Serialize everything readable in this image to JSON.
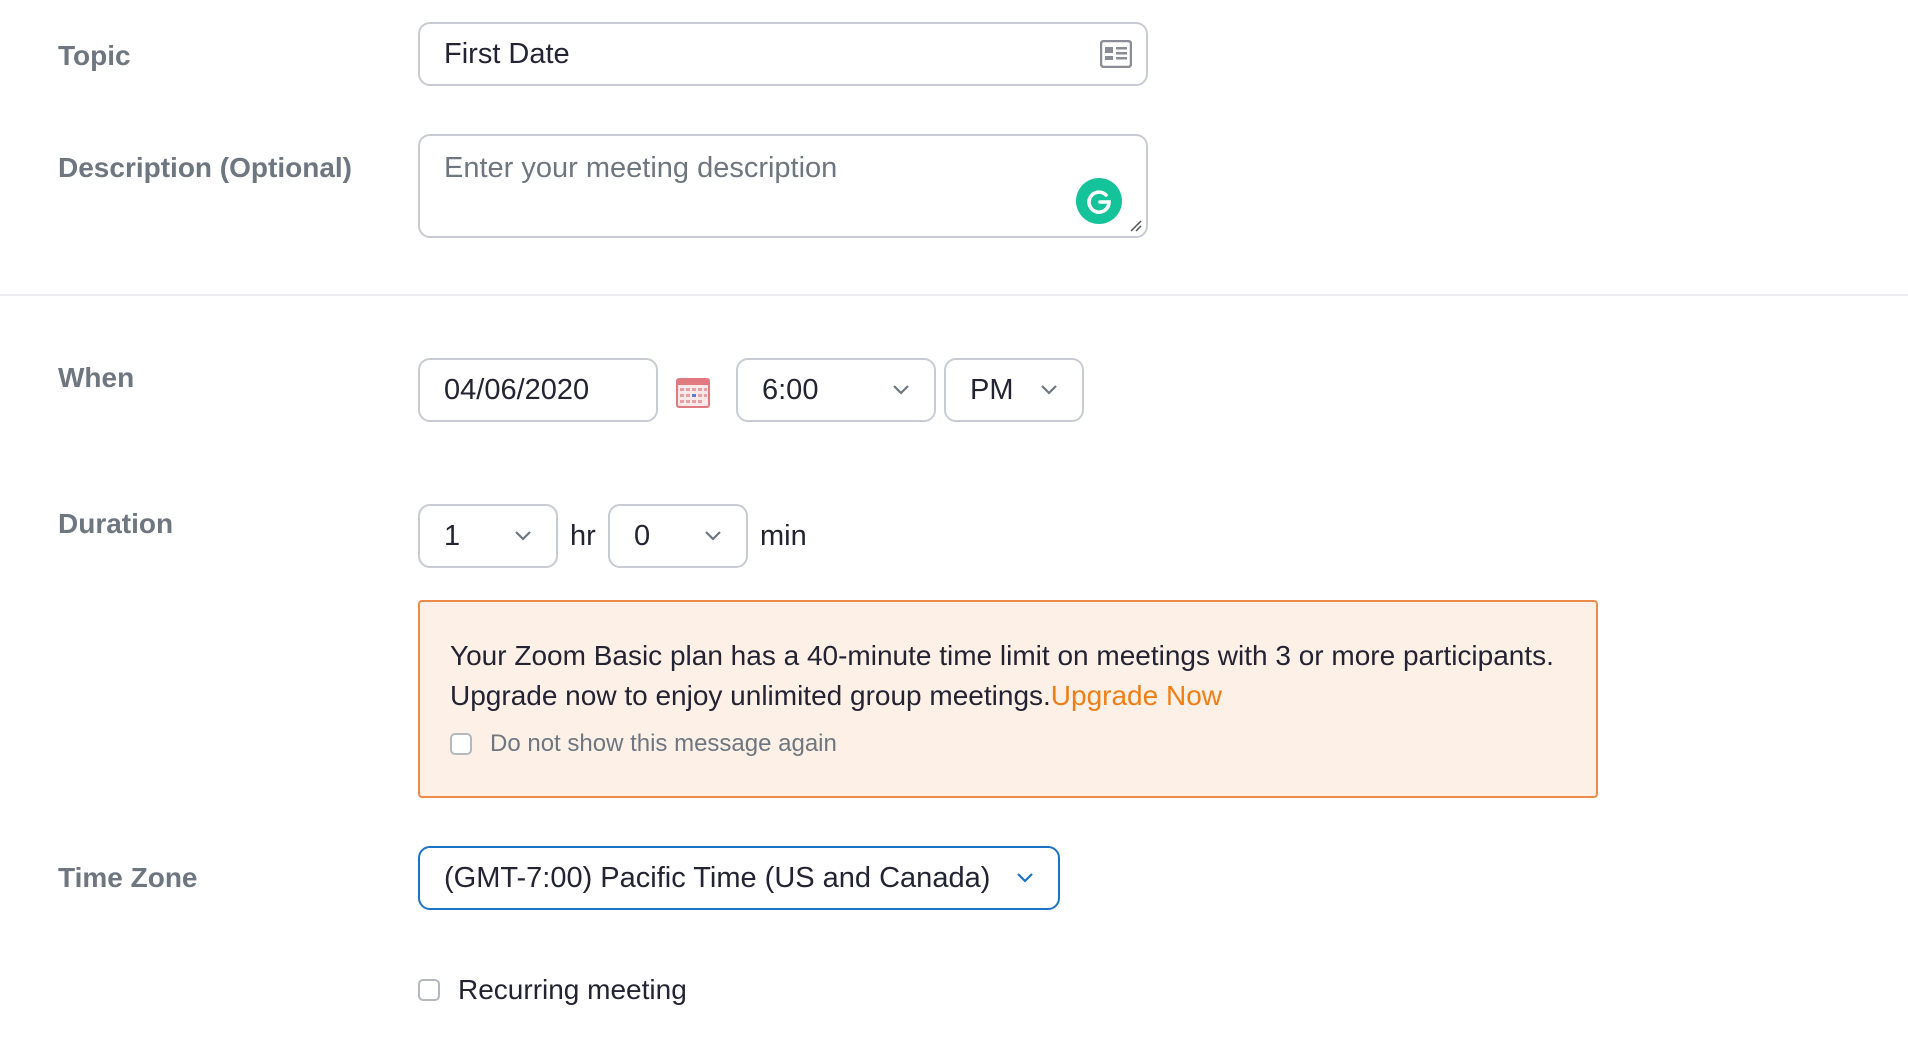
{
  "topic": {
    "label": "Topic",
    "value": "First Date",
    "icon": "contact-card-icon"
  },
  "description": {
    "label": "Description (Optional)",
    "placeholder": "Enter your meeting description",
    "icon": "grammarly-icon",
    "icon_color": "#15c39a"
  },
  "when": {
    "label": "When",
    "date": "04/06/2020",
    "time": "6:00",
    "ampm": "PM",
    "icon": "calendar-icon"
  },
  "duration": {
    "label": "Duration",
    "hours": "1",
    "hours_unit": "hr",
    "minutes": "0",
    "minutes_unit": "min"
  },
  "notice": {
    "text": "Your Zoom Basic plan has a 40-minute time limit on meetings with 3 or more participants. Upgrade now to enjoy unlimited group meetings.",
    "link_label": "Upgrade Now",
    "checkbox_label": "Do not show this message again",
    "border_color": "#ec8b4a",
    "background_color": "#fdf0e6",
    "link_color": "#f07e16"
  },
  "timezone": {
    "label": "Time Zone",
    "value": "(GMT-7:00) Pacific Time (US and Canada)",
    "focus_color": "#1a73c7"
  },
  "recurring": {
    "label": "Recurring meeting",
    "checked": false
  }
}
